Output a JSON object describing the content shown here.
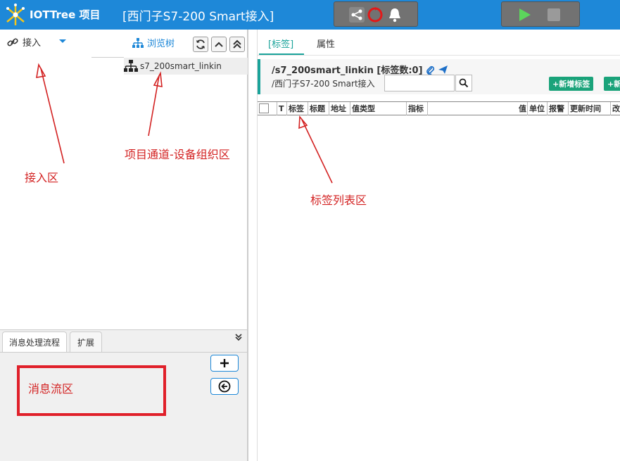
{
  "header": {
    "app_name": "IOTTree 项目",
    "project_title": "[西门子S7-200 Smart接入]"
  },
  "left_panel": {
    "access_tab_label": "接入",
    "browse_tree_label": "浏览树",
    "tree_node_label": "s7_200smart_linkin"
  },
  "bottom_panel": {
    "tabs": [
      "消息处理流程",
      "扩展"
    ],
    "msg_flow_label": "消息流区"
  },
  "annotations": {
    "access_area": "接入区",
    "project_channel_area": "项目通道-设备组织区",
    "tag_list_area": "标签列表区"
  },
  "right_panel": {
    "tabs": [
      "[标签]",
      "属性"
    ],
    "node_title": "/s7_200smart_linkin [标签数:0]",
    "node_path": "/西门子S7-200 Smart接入",
    "search_placeholder": "",
    "add_tag_button": "+新增标签",
    "add_more_button": "+新",
    "columns": [
      "T",
      "标签",
      "标题",
      "地址",
      "值类型",
      "指标",
      "值",
      "单位",
      "报警",
      "更新时间",
      "改"
    ]
  },
  "colors": {
    "header_bg": "#1e88d8",
    "accent_teal": "#1aa39a",
    "annotation_red": "#d32222",
    "button_green": "#1aa37a"
  }
}
